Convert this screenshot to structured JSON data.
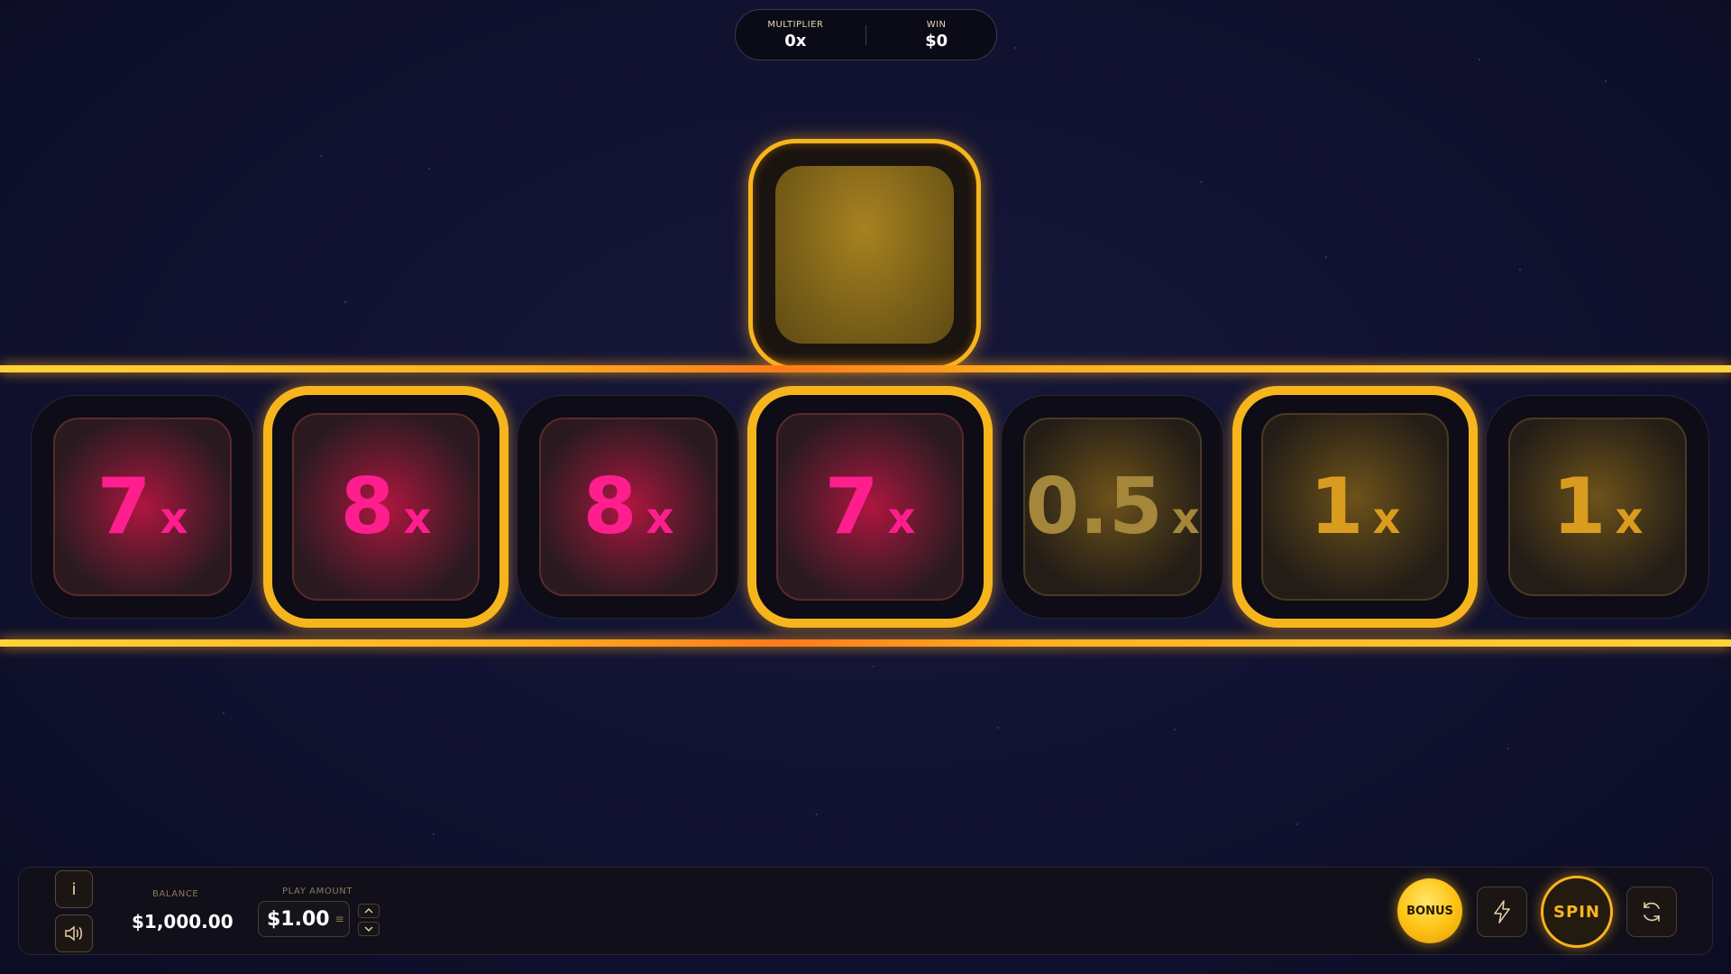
{
  "hud": {
    "multiplier_label": "MULTIPLIER",
    "multiplier_value": "0x",
    "win_label": "WIN",
    "win_value": "$0"
  },
  "reel": [
    {
      "number": "7",
      "suffix": "x",
      "tone": "pink",
      "highlighted": false
    },
    {
      "number": "8",
      "suffix": "x",
      "tone": "pink",
      "highlighted": true
    },
    {
      "number": "8",
      "suffix": "x",
      "tone": "pink",
      "highlighted": false
    },
    {
      "number": "7",
      "suffix": "x",
      "tone": "pink",
      "highlighted": true
    },
    {
      "number": "0.5",
      "suffix": "x",
      "tone": "gold-dim",
      "highlighted": false
    },
    {
      "number": "1",
      "suffix": "x",
      "tone": "gold",
      "highlighted": true
    },
    {
      "number": "1",
      "suffix": "x",
      "tone": "gold",
      "highlighted": false
    }
  ],
  "controls": {
    "info_label": "i",
    "balance_label": "BALANCE",
    "balance_value": "$1,000.00",
    "play_amount_label": "PLAY AMOUNT",
    "play_amount_value": "$1.00",
    "bonus_label": "BONUS",
    "spin_label": "SPIN"
  },
  "colors": {
    "accent": "#f7b51d",
    "pink": "#ff1e8e",
    "gold": "#d99c1e",
    "background": "#111230"
  },
  "icons": {
    "sound": "speaker-icon",
    "turbo": "lightning-icon",
    "autoplay": "refresh-icon",
    "menu": "menu-lines-icon"
  }
}
